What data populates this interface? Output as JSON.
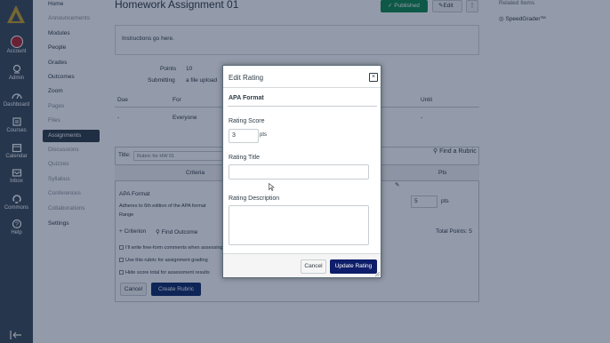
{
  "global_nav": {
    "items": [
      {
        "label": "Account",
        "icon": "account-avatar-icon"
      },
      {
        "label": "Admin",
        "icon": "admin-icon"
      },
      {
        "label": "Dashboard",
        "icon": "dashboard-icon"
      },
      {
        "label": "Courses",
        "icon": "courses-icon"
      },
      {
        "label": "Calendar",
        "icon": "calendar-icon"
      },
      {
        "label": "Inbox",
        "icon": "inbox-icon"
      },
      {
        "label": "Commons",
        "icon": "commons-icon"
      },
      {
        "label": "Help",
        "icon": "help-icon"
      }
    ]
  },
  "course_nav": {
    "items": [
      {
        "label": "Home",
        "state": "normal"
      },
      {
        "label": "Announcements",
        "state": "dim"
      },
      {
        "label": "Modules",
        "state": "normal"
      },
      {
        "label": "People",
        "state": "normal"
      },
      {
        "label": "Grades",
        "state": "normal"
      },
      {
        "label": "Outcomes",
        "state": "normal"
      },
      {
        "label": "Zoom",
        "state": "normal"
      },
      {
        "label": "Pages",
        "state": "dim"
      },
      {
        "label": "Files",
        "state": "dim"
      },
      {
        "label": "Assignments",
        "state": "active"
      },
      {
        "label": "Discussions",
        "state": "dim"
      },
      {
        "label": "Quizzes",
        "state": "dim"
      },
      {
        "label": "Syllabus",
        "state": "dim"
      },
      {
        "label": "Conferences",
        "state": "dim"
      },
      {
        "label": "Collaborations",
        "state": "dim"
      },
      {
        "label": "Settings",
        "state": "normal"
      }
    ]
  },
  "assignment": {
    "title": "Homework Assignment 01",
    "published_label": "Published",
    "edit_label": "Edit",
    "more_label": "⋮",
    "instructions": "Instructions go here.",
    "points_label": "Points",
    "points_value": "10",
    "submitting_label": "Submitting",
    "submitting_value": "a file upload",
    "table_headers": {
      "due": "Due",
      "for": "For",
      "until": "Until"
    },
    "table_row": {
      "due": "-",
      "for": "Everyone",
      "until": "-"
    }
  },
  "related": {
    "heading": "Related Items",
    "speedgrader": "SpeedGrader™"
  },
  "rubric": {
    "title_label": "Title:",
    "title_value": "Rubric for HW 01",
    "find_rubric": "Find a Rubric",
    "criteria_header": "Criteria",
    "pts_header": "Pts",
    "criterion_name": "APA Format",
    "criterion_desc": "Adheres to 6th edition of the APA format",
    "range_label": "Range",
    "pts_value": "5",
    "pts_unit": "pts",
    "add_criterion": "+ Criterion",
    "find_outcome": "Find Outcome",
    "total_points": "Total Points: 5",
    "opt1": "I'll write free-form comments when assessing",
    "opt2": "Use this rubric for assignment grading",
    "opt3": "Hide score total for assessment results",
    "cancel": "Cancel",
    "create": "Create Rubric"
  },
  "modal": {
    "title": "Edit Rating",
    "close": "×",
    "criterion": "APA Format",
    "score_label": "Rating Score",
    "score_value": "3",
    "pts_label": "pts",
    "title_label": "Rating Title",
    "title_value": "",
    "desc_label": "Rating Description",
    "desc_value": "",
    "cancel": "Cancel",
    "update": "Update Rating"
  }
}
